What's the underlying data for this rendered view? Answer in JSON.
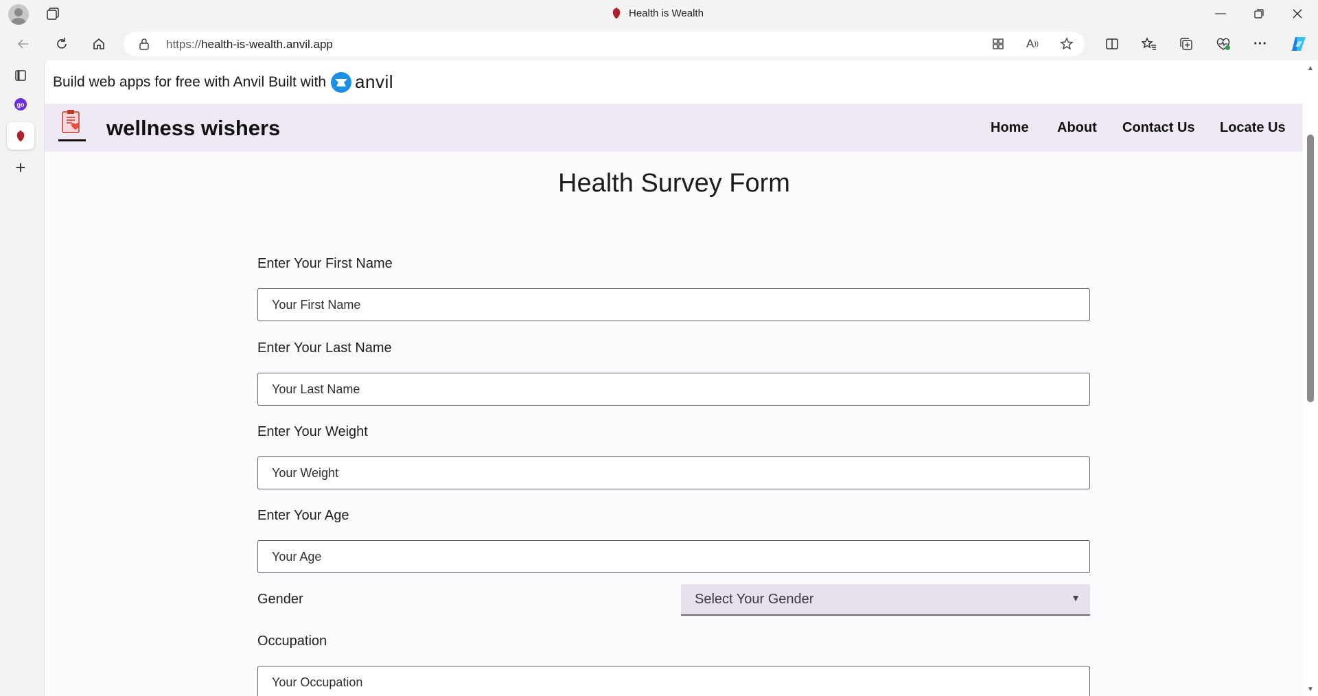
{
  "browser": {
    "tab_title": "Health is Wealth",
    "url_scheme": "https://",
    "url_host": "health-is-wealth.anvil.app",
    "icons": [
      "profile-icon",
      "tab-actions-icon",
      "back-icon",
      "refresh-icon",
      "home-icon",
      "lock-icon",
      "apps-icon",
      "read-aloud-icon",
      "favorite-icon",
      "split-screen-icon",
      "favorites-icon",
      "collections-icon",
      "browser-essentials-icon",
      "more-icon",
      "copilot-icon",
      "minimize-icon",
      "restore-icon",
      "close-icon"
    ]
  },
  "sidebar": {
    "items": [
      "tab-list-icon",
      "go-icon",
      "heart-tab-icon",
      "new-tab-icon"
    ]
  },
  "banner": {
    "text": "Build web apps for free with Anvil Built with",
    "logo_text": "anvil"
  },
  "app": {
    "brand": "wellness wishers",
    "nav": [
      "Home",
      "About",
      "Contact Us",
      "Locate Us"
    ]
  },
  "form": {
    "title": "Health Survey Form",
    "first_name_label": "Enter Your First Name",
    "first_name_placeholder": "Your First Name",
    "last_name_label": "Enter Your Last Name",
    "last_name_placeholder": "Your Last Name",
    "weight_label": "Enter Your Weight",
    "weight_placeholder": "Your Weight",
    "age_label": "Enter Your Age",
    "age_placeholder": "Your Age",
    "gender_label": "Gender",
    "gender_selected": "Select Your Gender",
    "occupation_label": "Occupation",
    "occupation_placeholder": "Your Occupation"
  },
  "colors": {
    "nav_bg": "#efe9f5",
    "page_bg": "#fcfbfe",
    "anvil_blue": "#1a8fe3"
  }
}
